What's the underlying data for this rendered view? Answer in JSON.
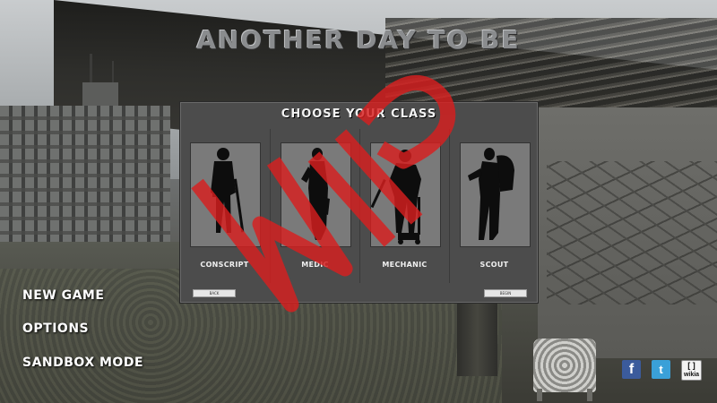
{
  "game_title": "ANOTHER DAY TO BE",
  "class_select": {
    "title": "CHOOSE YOUR CLASS",
    "classes": [
      {
        "label": "CONSCRIPT",
        "silhouette": "soldier-silhouette-icon"
      },
      {
        "label": "MEDIC",
        "silhouette": "medic-silhouette-icon"
      },
      {
        "label": "MECHANIC",
        "silhouette": "mechanic-silhouette-icon"
      },
      {
        "label": "SCOUT",
        "silhouette": "scout-silhouette-icon"
      }
    ],
    "back_label": "BACK",
    "begin_label": "BEGIN"
  },
  "main_menu": {
    "items": [
      "NEW GAME",
      "OPTIONS",
      "SANDBOX MODE"
    ]
  },
  "watermark": "WIP",
  "social": {
    "facebook": "f",
    "twitter": "t",
    "wiki": "wikia"
  },
  "colors": {
    "panel": "#4c4c4c",
    "watermark": "#d81f1f",
    "facebook": "#3b5b9c",
    "twitter": "#3aa0d8"
  }
}
